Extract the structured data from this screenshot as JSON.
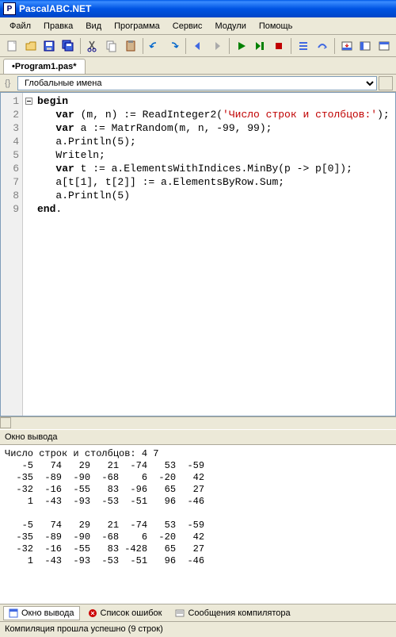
{
  "window": {
    "title": "PascalABC.NET"
  },
  "menu": {
    "file": "Файл",
    "edit": "Правка",
    "view": "Вид",
    "program": "Программа",
    "service": "Сервис",
    "modules": "Модули",
    "help": "Помощь"
  },
  "tab": {
    "name": "•Program1.pas*"
  },
  "nav": {
    "scope": "Глобальные имена"
  },
  "code": {
    "lines": [
      "1",
      "2",
      "3",
      "4",
      "5",
      "6",
      "7",
      "8",
      "9"
    ],
    "l1_kw": "begin",
    "l2_kw": "var",
    "l2_rest": " (m, n) := ReadInteger2(",
    "l2_str": "'Число строк и столбцов:'",
    "l2_end": ");",
    "l3_kw": "var",
    "l3_rest": " a := MatrRandom(m, n, -99, 99);",
    "l4": "a.Println(5);",
    "l5": "Writeln;",
    "l6_kw": "var",
    "l6_rest": " t := a.ElementsWithIndices.MinBy(p -> p[0]);",
    "l7": "a[t[1], t[2]] := a.ElementsByRow.Sum;",
    "l8": "a.Println(5)",
    "l9_kw": "end",
    "l9_end": "."
  },
  "output": {
    "title": "Окно вывода",
    "text": "Число строк и столбцов: 4 7\n   -5   74   29   21  -74   53  -59\n  -35  -89  -90  -68    6  -20   42\n  -32  -16  -55   83  -96   65   27\n    1  -43  -93  -53  -51   96  -46\n\n   -5   74   29   21  -74   53  -59\n  -35  -89  -90  -68    6  -20   42\n  -32  -16  -55   83 -428   65   27\n    1  -43  -93  -53  -51   96  -46"
  },
  "bottomTabs": {
    "output": "Окно вывода",
    "errors": "Список ошибок",
    "compiler": "Сообщения компилятора"
  },
  "status": {
    "text": "Компиляция прошла успешно (9 строк)"
  }
}
